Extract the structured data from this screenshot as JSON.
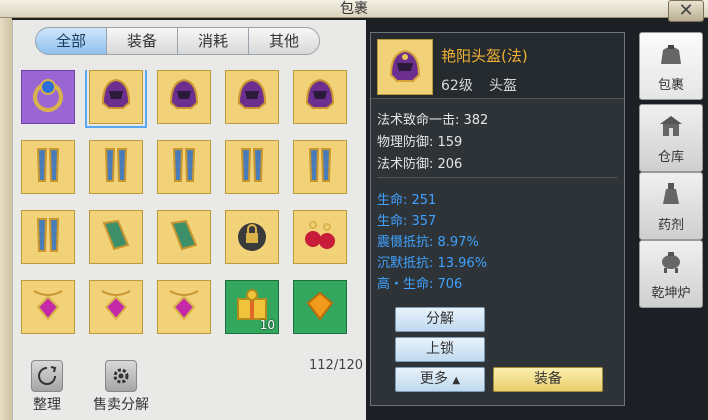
{
  "window": {
    "title": "包裹",
    "close_glyph": "✕"
  },
  "tabs": [
    {
      "label": "全部",
      "active": true
    },
    {
      "label": "装备",
      "active": false
    },
    {
      "label": "消耗",
      "active": false
    },
    {
      "label": "其他",
      "active": false
    }
  ],
  "inventory": {
    "capacity": "112/120",
    "slots": [
      {
        "icon": "ring-icon",
        "rarity": "purple"
      },
      {
        "icon": "helmet-icon",
        "rarity": "gold",
        "selected": true
      },
      {
        "icon": "helmet-icon",
        "rarity": "gold"
      },
      {
        "icon": "helmet-icon",
        "rarity": "gold"
      },
      {
        "icon": "helmet-icon",
        "rarity": "gold"
      },
      {
        "icon": "greaves-icon",
        "rarity": "gold"
      },
      {
        "icon": "greaves-icon",
        "rarity": "gold"
      },
      {
        "icon": "greaves-icon",
        "rarity": "gold"
      },
      {
        "icon": "greaves-icon",
        "rarity": "gold"
      },
      {
        "icon": "greaves-icon",
        "rarity": "gold"
      },
      {
        "icon": "greaves-icon",
        "rarity": "gold"
      },
      {
        "icon": "bracer-icon",
        "rarity": "gold"
      },
      {
        "icon": "bracer-icon",
        "rarity": "gold"
      },
      {
        "icon": "locked-bag-icon",
        "rarity": "gold"
      },
      {
        "icon": "earring-icon",
        "rarity": "gold"
      },
      {
        "icon": "amulet-icon",
        "rarity": "gold"
      },
      {
        "icon": "amulet-icon",
        "rarity": "gold"
      },
      {
        "icon": "amulet-icon",
        "rarity": "gold"
      },
      {
        "icon": "gift-box-icon",
        "rarity": "green",
        "count": "10"
      },
      {
        "icon": "gem-icon",
        "rarity": "green"
      }
    ]
  },
  "tools": {
    "sort_label": "整理",
    "sell_label": "售卖分解"
  },
  "detail": {
    "name": "艳阳头盔(法)",
    "level": "62级",
    "type": "头盔",
    "base_stats": [
      "法术致命一击: 382",
      "物理防御: 159",
      "法术防御: 206"
    ],
    "extra_stats": [
      "生命: 251",
      "生命: 357",
      "震慑抵抗: 8.97%",
      "沉默抵抗: 13.96%",
      "高・生命: 706"
    ],
    "buttons": {
      "decompose": "分解",
      "lock": "上锁",
      "more": "更多",
      "equip": "装备"
    }
  },
  "sidenav": [
    {
      "label": "包裹",
      "icon": "bag-icon",
      "active": true
    },
    {
      "label": "仓库",
      "icon": "warehouse-icon",
      "active": false
    },
    {
      "label": "药剂",
      "icon": "potion-icon",
      "active": false
    },
    {
      "label": "乾坤炉",
      "icon": "furnace-icon",
      "active": false
    }
  ],
  "colors": {
    "item_name": "#f2b233",
    "stat_blue": "#3fa2ff",
    "gold_slot": "#f1d278",
    "purple_slot": "#9a66d3",
    "green_slot": "#33a75d"
  }
}
